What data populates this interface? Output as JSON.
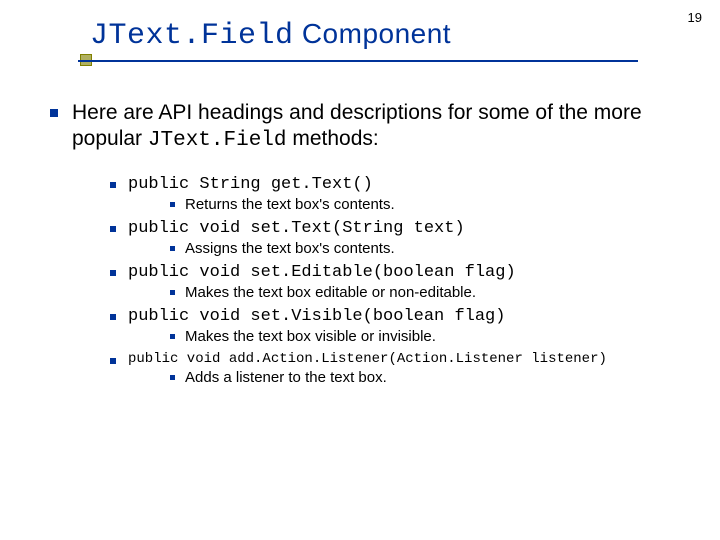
{
  "page_number": "19",
  "title": {
    "mono": "JText.Field",
    "rest": " Component"
  },
  "intro": {
    "pre": "Here are API headings and descriptions for some of the more popular ",
    "mono": "JText.Field",
    "post": " methods:"
  },
  "methods": [
    {
      "sig": "public String get.Text()",
      "desc": "Returns the text box's contents."
    },
    {
      "sig": "public void set.Text(String text)",
      "desc": "Assigns the text box's contents."
    },
    {
      "sig": "public void set.Editable(boolean flag)",
      "desc": "Makes the text box editable or non-editable."
    },
    {
      "sig": "public void set.Visible(boolean flag)",
      "desc": "Makes the text box visible or invisible."
    },
    {
      "sig": "public void add.Action.Listener(Action.Listener listener)",
      "desc": "Adds a listener to the text box."
    }
  ]
}
